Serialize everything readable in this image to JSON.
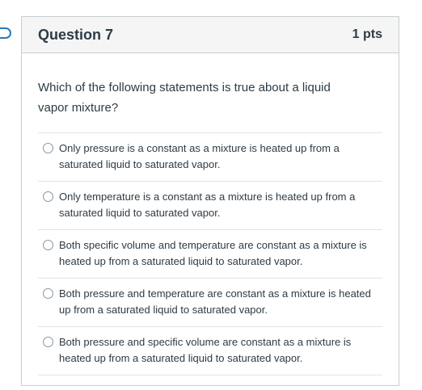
{
  "question": {
    "title": "Question 7",
    "points": "1 pts",
    "text": "Which of the following statements is true about a liquid vapor mixture?",
    "answers": [
      {
        "label": "Only pressure is a constant as a mixture is heated up from a saturated liquid to saturated vapor."
      },
      {
        "label": "Only temperature is a constant as a mixture is heated up from a saturated liquid to saturated vapor."
      },
      {
        "label": "Both specific volume and temperature are constant as a mixture is heated up from a saturated liquid to saturated vapor."
      },
      {
        "label": "Both pressure and temperature are constant as a mixture is heated up from a saturated liquid to saturated vapor."
      },
      {
        "label": "Both pressure and specific volume are constant as a mixture is heated up from a saturated liquid to saturated vapor."
      }
    ]
  },
  "colors": {
    "header_bg": "#f5f5f5",
    "border": "#c7cdd1",
    "text": "#2d3b45",
    "bookmark": "#2b7abc"
  },
  "icons": {
    "bookmark": "bookmark-icon",
    "radio": "radio-unselected"
  }
}
